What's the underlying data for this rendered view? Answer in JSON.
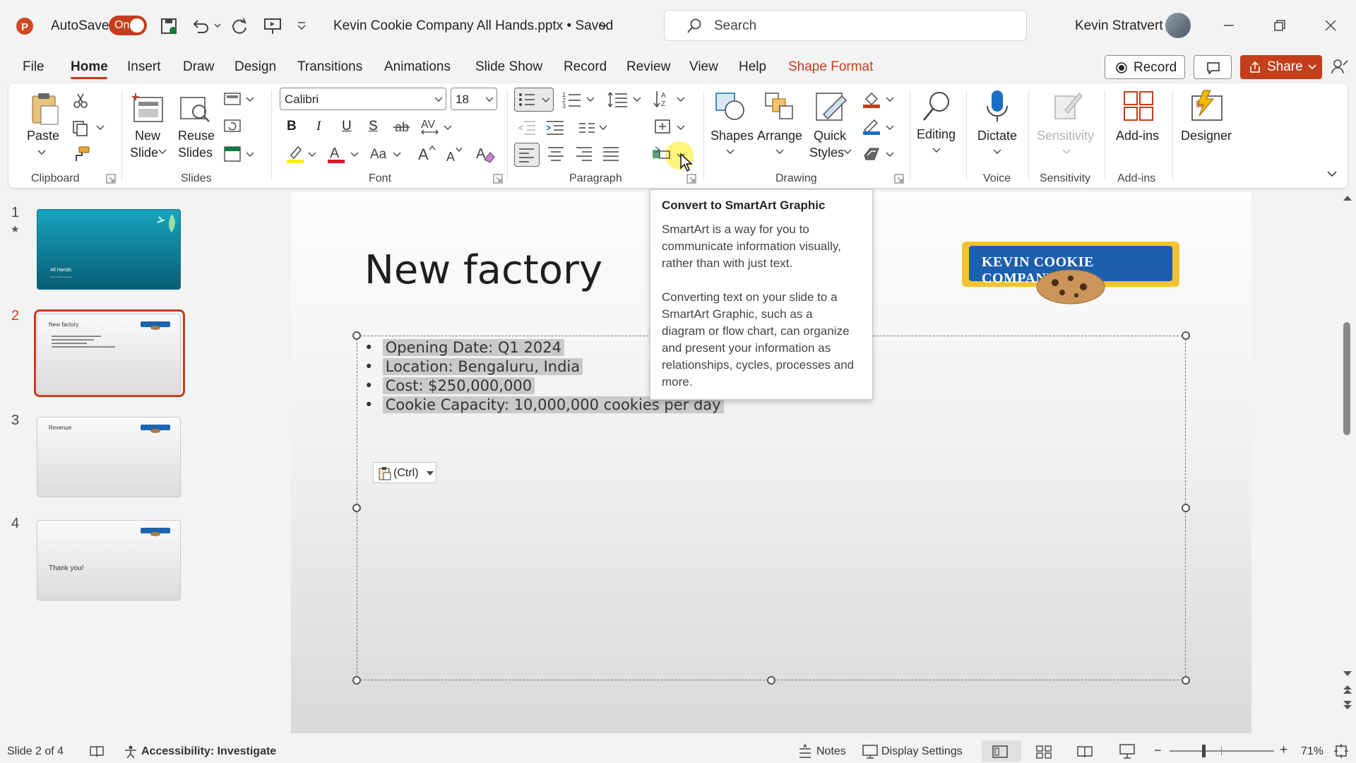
{
  "titlebar": {
    "autosave_label": "AutoSave",
    "autosave_state": "On",
    "file_title": "Kevin Cookie Company All Hands.pptx • Saved",
    "search_placeholder": "Search",
    "user_name": "Kevin Stratvert"
  },
  "tabs": [
    "File",
    "Home",
    "Insert",
    "Draw",
    "Design",
    "Transitions",
    "Animations",
    "Slide Show",
    "Record",
    "Review",
    "View",
    "Help",
    "Shape Format"
  ],
  "tab_actions": {
    "record": "Record",
    "share": "Share"
  },
  "ribbon": {
    "clipboard": {
      "label": "Clipboard",
      "paste": "Paste"
    },
    "slides": {
      "label": "Slides",
      "new_slide": [
        "New",
        "Slide"
      ],
      "reuse_slides": [
        "Reuse",
        "Slides"
      ]
    },
    "font": {
      "label": "Font",
      "font_name": "Calibri",
      "font_size": "18",
      "bold": "B",
      "italic": "I",
      "underline": "U",
      "strike": "S",
      "change_case": "Aa"
    },
    "paragraph": {
      "label": "Paragraph"
    },
    "drawing": {
      "label": "Drawing",
      "shapes": "Shapes",
      "arrange": "Arrange",
      "quick_styles": [
        "Quick",
        "Styles"
      ]
    },
    "editing": {
      "label": "Editing"
    },
    "voice": {
      "label": "Voice",
      "dictate": "Dictate"
    },
    "sensitivity": {
      "label": "Sensitivity",
      "button": "Sensitivity"
    },
    "addins": {
      "label": "Add-ins",
      "button": "Add-ins"
    },
    "designer": {
      "button": "Designer"
    }
  },
  "thumbnails": [
    {
      "num": "1",
      "text": "All Hands",
      "sub": "Kevin Cookie Company"
    },
    {
      "num": "2",
      "text": "New factory"
    },
    {
      "num": "3",
      "text": "Revenue"
    },
    {
      "num": "4",
      "text": "Thank you!"
    }
  ],
  "slide": {
    "title": "New factory",
    "bullets": [
      "Opening Date: Q1 2024",
      "Location: Bengaluru, India",
      "Cost: $250,000,000",
      "Cookie Capacity: 10,000,000 cookies per day"
    ],
    "paste_options": "(Ctrl)",
    "logo_text": "KEVIN COOKIE COMPANY"
  },
  "tooltip": {
    "title": "Convert to SmartArt Graphic",
    "para1": [
      "SmartArt is a way for you to",
      "communicate information visually,",
      "rather than with just text."
    ],
    "para2": [
      "Converting text on your slide to a",
      "SmartArt Graphic, such as a",
      "diagram or flow chart, can organize",
      "and present your information as",
      "relationships, cycles, processes and",
      "more."
    ]
  },
  "statusbar": {
    "slide_info": "Slide 2 of 4",
    "accessibility": "Accessibility: Investigate",
    "notes": "Notes",
    "display_settings": "Display Settings",
    "zoom": "71%"
  },
  "colors": {
    "accent": "#c43e1c",
    "slide_teal": "#0e7fa3"
  }
}
